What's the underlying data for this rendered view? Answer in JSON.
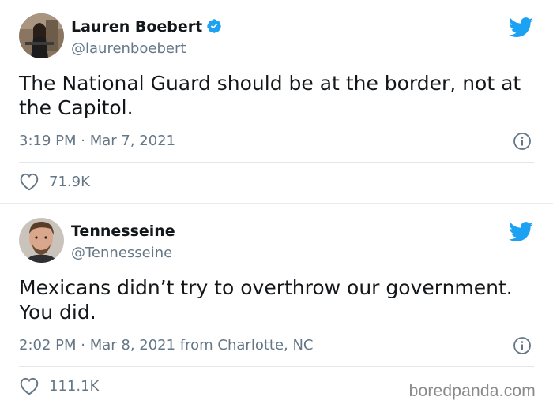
{
  "tweets": [
    {
      "name": "Lauren Boebert",
      "verified": true,
      "handle": "@laurenboebert",
      "text": "The National Guard should be at the border, not at the Capitol.",
      "meta": "3:19 PM · Mar 7, 2021",
      "likes": "71.9K"
    },
    {
      "name": "Tennesseine",
      "verified": false,
      "handle": "@Tennesseine",
      "text": "Mexicans didn’t try to overthrow our government. You did.",
      "meta": "2:02 PM · Mar 8, 2021 from Charlotte, NC",
      "likes": "111.1K"
    }
  ],
  "watermark": "boredpanda.com",
  "colors": {
    "twitter_blue": "#1da1f2",
    "secondary_text": "#657786",
    "primary_text": "#14171a"
  },
  "icons": [
    "verified-badge-icon",
    "twitter-bird-icon",
    "info-icon",
    "heart-icon"
  ]
}
